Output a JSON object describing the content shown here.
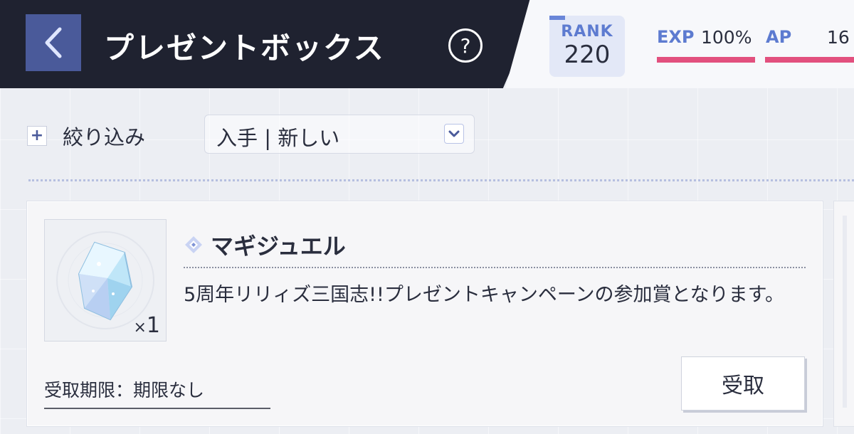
{
  "header": {
    "title": "プレゼントボックス",
    "help_label": "?",
    "rank_label": "RANK",
    "rank_value": "220",
    "exp_label": "EXP",
    "exp_value": "100%",
    "ap_label": "AP",
    "ap_value": "16",
    "exp_progress": 1.0
  },
  "filter": {
    "icon_label": "+",
    "label": "絞り込み",
    "sort_value": "入手 | 新しい"
  },
  "present": {
    "item_name": "マギジュエル",
    "quantity_prefix": "×",
    "quantity": "1",
    "description": "5周年リリィズ三国志!!プレゼントキャンペーンの参加賞となります。",
    "expiry": "受取期限：期限なし",
    "receive_label": "受取"
  },
  "colors": {
    "header_dark": "#1f2230",
    "back_button": "#4a5a9a",
    "accent_blue": "#5d7bd0",
    "bar_pink": "#e2507e"
  },
  "icons": [
    "back-arrow-icon",
    "help-icon",
    "plus-icon",
    "chevron-down-icon",
    "diamond-icon",
    "magi-jewel-icon"
  ]
}
